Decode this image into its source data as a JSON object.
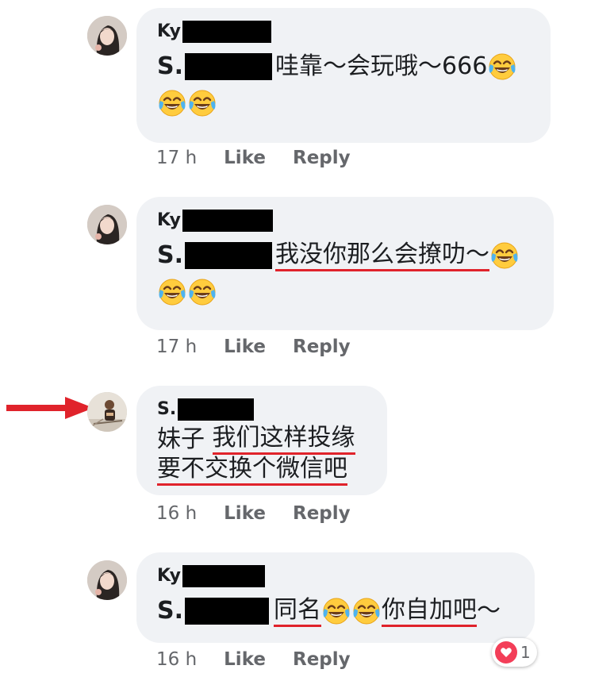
{
  "comments": [
    {
      "author_visible": "Ky",
      "mention_visible": "S.",
      "text": "哇靠～会玩哦～666",
      "time": "17 h"
    },
    {
      "author_visible": "Ky",
      "mention_visible": "S.",
      "text": "我没你那么会撩叻～",
      "time": "17 h"
    },
    {
      "author_visible": "S.",
      "line1_plain": "妹子 ",
      "line1_underlined": "我们这样投缘",
      "line2_underlined": "要不交换个微信吧",
      "time": "16 h"
    },
    {
      "author_visible": "Ky",
      "mention_visible": "S.",
      "text_a": "同名",
      "text_b": "你自加吧",
      "text_tail": "～",
      "time": "16 h",
      "reaction_count": "1"
    }
  ],
  "actions": {
    "like": "Like",
    "reply": "Reply"
  },
  "colors": {
    "bubble": "#f0f2f5",
    "underline": "#e0232b",
    "arrow": "#e0232b",
    "heart": "#f33e58"
  },
  "icons": {
    "emoji": "face-with-tears-of-joy-icon",
    "reaction": "heart-icon",
    "pointer": "red-arrow-icon"
  }
}
